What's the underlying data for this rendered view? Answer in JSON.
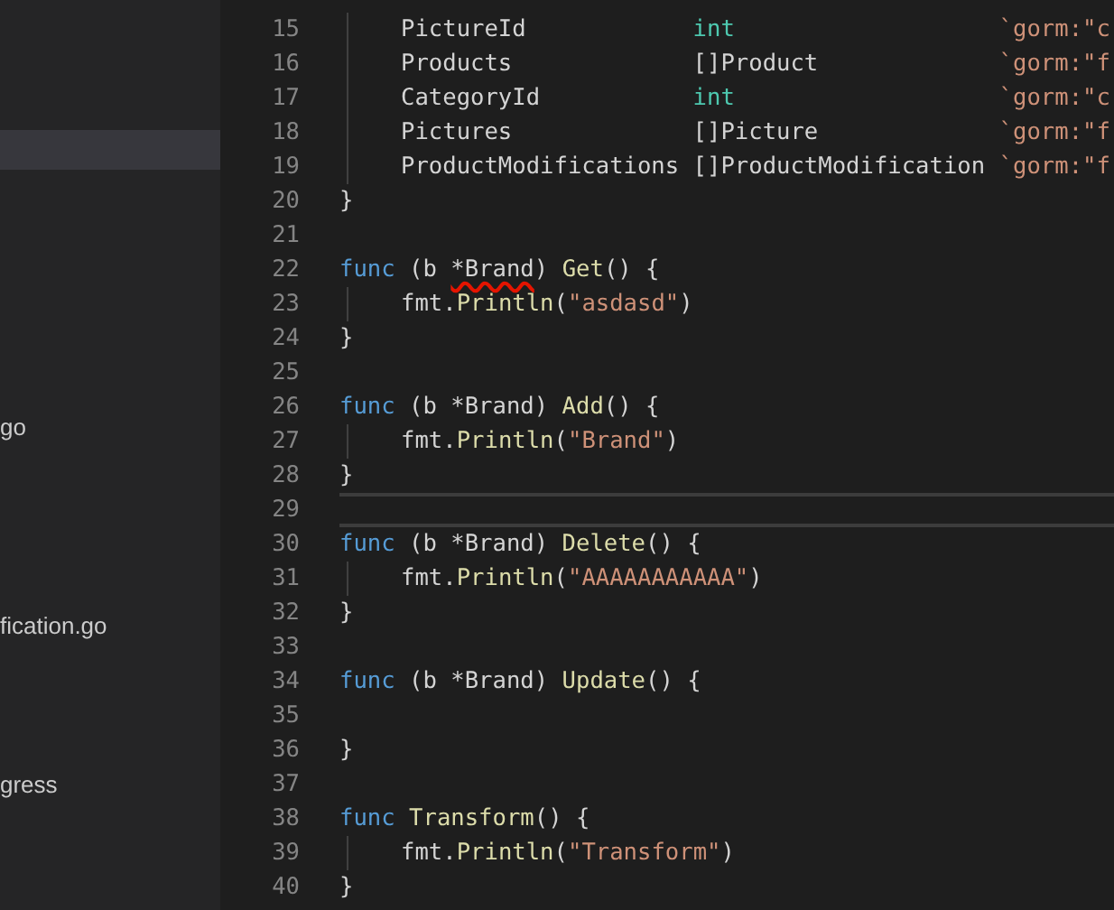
{
  "sidebar": {
    "items": [
      {
        "selected": true
      },
      {
        "label": "go",
        "selected": false
      },
      {
        "label": "fication.go",
        "selected": false
      },
      {
        "label": "gress",
        "selected": false
      }
    ]
  },
  "editor": {
    "lines": [
      {
        "number": "15",
        "indented": true,
        "current": false,
        "tokens": [
          {
            "text": "PictureId            ",
            "kind": "plain",
            "error": false
          },
          {
            "text": "int                   ",
            "kind": "builtin",
            "error": false
          },
          {
            "text": "`gorm:\"c",
            "kind": "string",
            "error": false
          }
        ]
      },
      {
        "number": "16",
        "indented": true,
        "current": false,
        "tokens": [
          {
            "text": "Products             []Product             ",
            "kind": "plain",
            "error": false
          },
          {
            "text": "`gorm:\"f",
            "kind": "string",
            "error": false
          }
        ]
      },
      {
        "number": "17",
        "indented": true,
        "current": false,
        "tokens": [
          {
            "text": "CategoryId           ",
            "kind": "plain",
            "error": false
          },
          {
            "text": "int                   ",
            "kind": "builtin",
            "error": false
          },
          {
            "text": "`gorm:\"c",
            "kind": "string",
            "error": false
          }
        ]
      },
      {
        "number": "18",
        "indented": true,
        "current": false,
        "tokens": [
          {
            "text": "Pictures             []Picture             ",
            "kind": "plain",
            "error": false
          },
          {
            "text": "`gorm:\"f",
            "kind": "string",
            "error": false
          }
        ]
      },
      {
        "number": "19",
        "indented": true,
        "current": false,
        "tokens": [
          {
            "text": "ProductModifications []ProductModification ",
            "kind": "plain",
            "error": false
          },
          {
            "text": "`gorm:\"f",
            "kind": "string",
            "error": false
          }
        ]
      },
      {
        "number": "20",
        "indented": false,
        "current": false,
        "tokens": [
          {
            "text": "}",
            "kind": "plain",
            "error": false
          }
        ]
      },
      {
        "number": "21",
        "indented": false,
        "current": false
      },
      {
        "number": "22",
        "indented": false,
        "current": false,
        "tokens": [
          {
            "text": "func",
            "kind": "keyword",
            "error": false
          },
          {
            "text": " (b ",
            "kind": "plain",
            "error": false
          },
          {
            "text": "*Brand",
            "kind": "plain",
            "error": true
          },
          {
            "text": ") ",
            "kind": "plain",
            "error": false
          },
          {
            "text": "Get",
            "kind": "function",
            "error": false
          },
          {
            "text": "() {",
            "kind": "plain",
            "error": false
          }
        ]
      },
      {
        "number": "23",
        "indented": true,
        "current": false,
        "tokens": [
          {
            "text": "fmt.",
            "kind": "plain",
            "error": false
          },
          {
            "text": "Println",
            "kind": "function",
            "error": false
          },
          {
            "text": "(",
            "kind": "plain",
            "error": false
          },
          {
            "text": "\"asdasd\"",
            "kind": "string",
            "error": false
          },
          {
            "text": ")",
            "kind": "plain",
            "error": false
          }
        ]
      },
      {
        "number": "24",
        "indented": false,
        "current": false,
        "tokens": [
          {
            "text": "}",
            "kind": "plain",
            "error": false
          }
        ]
      },
      {
        "number": "25",
        "indented": false,
        "current": false
      },
      {
        "number": "26",
        "indented": false,
        "current": false,
        "tokens": [
          {
            "text": "func",
            "kind": "keyword",
            "error": false
          },
          {
            "text": " (b *Brand) ",
            "kind": "plain",
            "error": false
          },
          {
            "text": "Add",
            "kind": "function",
            "error": false
          },
          {
            "text": "() {",
            "kind": "plain",
            "error": false
          }
        ]
      },
      {
        "number": "27",
        "indented": true,
        "current": false,
        "tokens": [
          {
            "text": "fmt.",
            "kind": "plain",
            "error": false
          },
          {
            "text": "Println",
            "kind": "function",
            "error": false
          },
          {
            "text": "(",
            "kind": "plain",
            "error": false
          },
          {
            "text": "\"Brand\"",
            "kind": "string",
            "error": false
          },
          {
            "text": ")",
            "kind": "plain",
            "error": false
          }
        ]
      },
      {
        "number": "28",
        "indented": false,
        "current": false,
        "tokens": [
          {
            "text": "}",
            "kind": "plain",
            "error": false
          }
        ]
      },
      {
        "number": "29",
        "indented": false,
        "current": true
      },
      {
        "number": "30",
        "indented": false,
        "current": false,
        "tokens": [
          {
            "text": "func",
            "kind": "keyword",
            "error": false
          },
          {
            "text": " (b *Brand) ",
            "kind": "plain",
            "error": false
          },
          {
            "text": "Delete",
            "kind": "function",
            "error": false
          },
          {
            "text": "() {",
            "kind": "plain",
            "error": false
          }
        ]
      },
      {
        "number": "31",
        "indented": true,
        "current": false,
        "tokens": [
          {
            "text": "fmt.",
            "kind": "plain",
            "error": false
          },
          {
            "text": "Println",
            "kind": "function",
            "error": false
          },
          {
            "text": "(",
            "kind": "plain",
            "error": false
          },
          {
            "text": "\"AAAAAAAAAAA\"",
            "kind": "string",
            "error": false
          },
          {
            "text": ")",
            "kind": "plain",
            "error": false
          }
        ]
      },
      {
        "number": "32",
        "indented": false,
        "current": false,
        "tokens": [
          {
            "text": "}",
            "kind": "plain",
            "error": false
          }
        ]
      },
      {
        "number": "33",
        "indented": false,
        "current": false
      },
      {
        "number": "34",
        "indented": false,
        "current": false,
        "tokens": [
          {
            "text": "func",
            "kind": "keyword",
            "error": false
          },
          {
            "text": " (b *Brand) ",
            "kind": "plain",
            "error": false
          },
          {
            "text": "Update",
            "kind": "function",
            "error": false
          },
          {
            "text": "() {",
            "kind": "plain",
            "error": false
          }
        ]
      },
      {
        "number": "35",
        "indented": false,
        "current": false
      },
      {
        "number": "36",
        "indented": false,
        "current": false,
        "tokens": [
          {
            "text": "}",
            "kind": "plain",
            "error": false
          }
        ]
      },
      {
        "number": "37",
        "indented": false,
        "current": false
      },
      {
        "number": "38",
        "indented": false,
        "current": false,
        "tokens": [
          {
            "text": "func ",
            "kind": "keyword",
            "error": false
          },
          {
            "text": "Transform",
            "kind": "function",
            "error": false
          },
          {
            "text": "() {",
            "kind": "plain",
            "error": false
          }
        ]
      },
      {
        "number": "39",
        "indented": true,
        "current": false,
        "tokens": [
          {
            "text": "fmt.",
            "kind": "plain",
            "error": false
          },
          {
            "text": "Println",
            "kind": "function",
            "error": false
          },
          {
            "text": "(",
            "kind": "plain",
            "error": false
          },
          {
            "text": "\"Transform\"",
            "kind": "string",
            "error": false
          },
          {
            "text": ")",
            "kind": "plain",
            "error": false
          }
        ]
      },
      {
        "number": "40",
        "indented": false,
        "current": false,
        "tokens": [
          {
            "text": "}",
            "kind": "plain",
            "error": false
          }
        ]
      }
    ]
  }
}
